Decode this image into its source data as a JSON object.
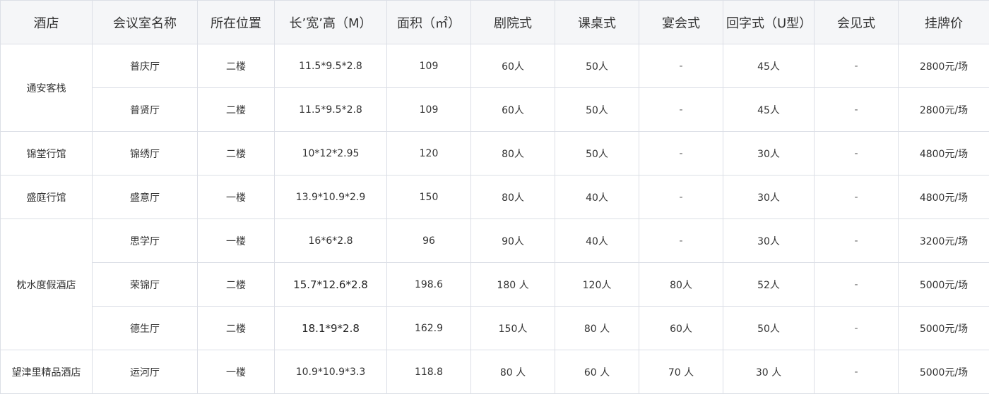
{
  "table": {
    "headers": [
      "酒店",
      "会议室名称",
      "所在位置",
      "长’宽’高（M）",
      "面积（㎡）",
      "剧院式",
      "课桌式",
      "宴会式",
      "回字式（U型）",
      "会见式",
      "挂牌价"
    ],
    "groups": [
      {
        "hotel": "通安客栈",
        "rooms": [
          [
            "普庆厅",
            "二楼",
            "11.5*9.5*2.8",
            "109",
            "60人",
            "50人",
            "-",
            "45人",
            "-",
            "2800元/场"
          ],
          [
            "普贤厅",
            "二楼",
            "11.5*9.5*2.8",
            "109",
            "60人",
            "50人",
            "-",
            "45人",
            "-",
            "2800元/场"
          ]
        ]
      },
      {
        "hotel": "锦堂行馆",
        "rooms": [
          [
            "锦绣厅",
            "二楼",
            "10*12*2.95",
            "120",
            "80人",
            "50人",
            "-",
            "30人",
            "-",
            "4800元/场"
          ]
        ]
      },
      {
        "hotel": "盛庭行馆",
        "rooms": [
          [
            "盛意厅",
            "一楼",
            "13.9*10.9*2.9",
            "150",
            "80人",
            "40人",
            "-",
            "30人",
            "-",
            "4800元/场"
          ]
        ]
      },
      {
        "hotel": "枕水度假酒店",
        "rooms": [
          [
            "思学厅",
            "一楼",
            "16*6*2.8",
            "96",
            "90人",
            "40人",
            "-",
            "30人",
            "-",
            "3200元/场"
          ],
          [
            "荣锦厅",
            "二楼",
            "15.7*12.6*2.8",
            "198.6",
            "180 人",
            "120人",
            "80人",
            "52人",
            "-",
            "5000元/场"
          ],
          [
            "德生厅",
            "二楼",
            "18.1*9*2.8",
            "162.9",
            "150人",
            "80 人",
            "60人",
            "50人",
            "-",
            "5000元/场"
          ]
        ]
      },
      {
        "hotel": "望津里精品酒店",
        "rooms": [
          [
            "运河厅",
            "一楼",
            "10.9*10.9*3.3",
            "118.8",
            "80 人",
            "60 人",
            "70 人",
            "30 人",
            "-",
            "5000元/场"
          ]
        ]
      }
    ]
  }
}
